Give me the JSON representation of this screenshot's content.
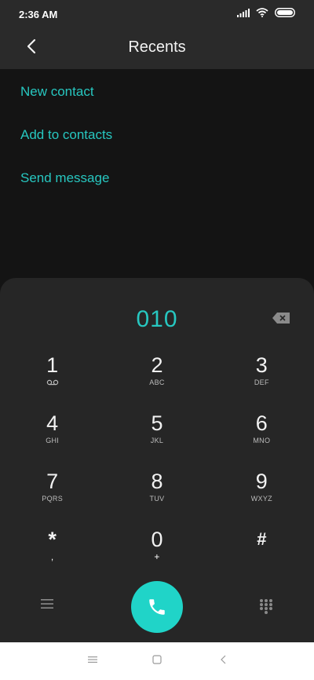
{
  "status": {
    "time": "2:36 AM"
  },
  "header": {
    "title": "Recents"
  },
  "menu": [
    "New contact",
    "Add to contacts",
    "Send message"
  ],
  "dialer": {
    "number": "010",
    "keys": [
      {
        "digit": "1",
        "letters": ""
      },
      {
        "digit": "2",
        "letters": "ABC"
      },
      {
        "digit": "3",
        "letters": "DEF"
      },
      {
        "digit": "4",
        "letters": "GHI"
      },
      {
        "digit": "5",
        "letters": "JKL"
      },
      {
        "digit": "6",
        "letters": "MNO"
      },
      {
        "digit": "7",
        "letters": "PQRS"
      },
      {
        "digit": "8",
        "letters": "TUV"
      },
      {
        "digit": "9",
        "letters": "WXYZ"
      },
      {
        "digit": "*",
        "letters": ","
      },
      {
        "digit": "0",
        "letters": "+"
      },
      {
        "digit": "#",
        "letters": ""
      }
    ]
  },
  "colors": {
    "accent": "#27c7c0",
    "call_button": "#20d4c8",
    "sheet": "#262626",
    "background": "#141414"
  }
}
